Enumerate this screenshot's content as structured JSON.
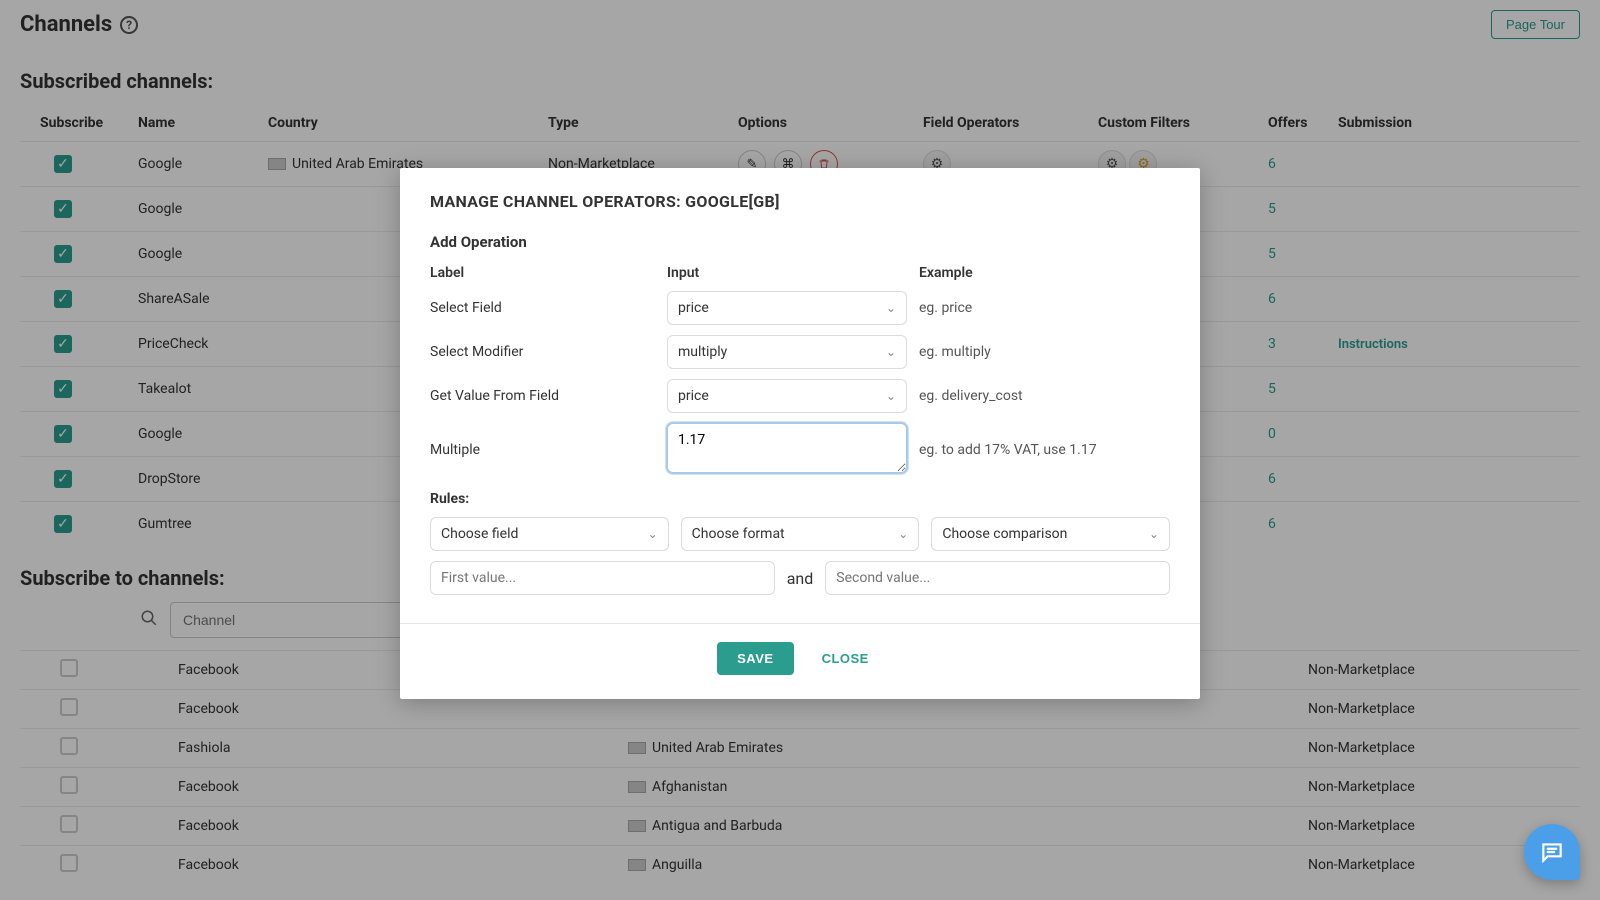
{
  "header": {
    "title": "Channels",
    "page_tour": "Page Tour"
  },
  "subscribed": {
    "title": "Subscribed channels:",
    "columns": {
      "subscribe": "Subscribe",
      "name": "Name",
      "country": "Country",
      "type": "Type",
      "options": "Options",
      "field_operators": "Field Operators",
      "custom_filters": "Custom Filters",
      "offers": "Offers",
      "submission": "Submission"
    },
    "rows": [
      {
        "name": "Google",
        "country": "United Arab Emirates",
        "type": "Non-Marketplace",
        "offers": "6",
        "submission": ""
      },
      {
        "name": "Google",
        "country": "",
        "type": "",
        "offers": "5",
        "submission": ""
      },
      {
        "name": "Google",
        "country": "",
        "type": "",
        "offers": "5",
        "submission": ""
      },
      {
        "name": "ShareASale",
        "country": "",
        "type": "",
        "offers": "6",
        "submission": ""
      },
      {
        "name": "PriceCheck",
        "country": "",
        "type": "",
        "offers": "3",
        "submission": "Instructions"
      },
      {
        "name": "Takealot",
        "country": "",
        "type": "",
        "offers": "5",
        "submission": ""
      },
      {
        "name": "Google",
        "country": "",
        "type": "",
        "offers": "0",
        "submission": ""
      },
      {
        "name": "DropStore",
        "country": "",
        "type": "",
        "offers": "6",
        "submission": ""
      },
      {
        "name": "Gumtree",
        "country": "",
        "type": "",
        "offers": "6",
        "submission": ""
      }
    ]
  },
  "available": {
    "title": "Subscribe to channels:",
    "search_placeholder": "Channel",
    "rows": [
      {
        "name": "Facebook",
        "country": "",
        "type": "Non-Marketplace"
      },
      {
        "name": "Facebook",
        "country": "",
        "type": "Non-Marketplace"
      },
      {
        "name": "Fashiola",
        "country": "United Arab Emirates",
        "type": "Non-Marketplace"
      },
      {
        "name": "Facebook",
        "country": "Afghanistan",
        "type": "Non-Marketplace"
      },
      {
        "name": "Facebook",
        "country": "Antigua and Barbuda",
        "type": "Non-Marketplace"
      },
      {
        "name": "Facebook",
        "country": "Anguilla",
        "type": "Non-Marketplace"
      }
    ]
  },
  "modal": {
    "title": "MANAGE CHANNEL OPERATORS: GOOGLE[GB]",
    "subtitle": "Add Operation",
    "headers": {
      "label": "Label",
      "input": "Input",
      "example": "Example"
    },
    "rows": {
      "select_field": {
        "label": "Select Field",
        "value": "price",
        "example": "eg. price"
      },
      "select_modifier": {
        "label": "Select Modifier",
        "value": "multiply",
        "example": "eg. multiply"
      },
      "get_value": {
        "label": "Get Value From Field",
        "value": "price",
        "example": "eg. delivery_cost"
      },
      "multiple": {
        "label": "Multiple",
        "value": "1.17",
        "example": "eg. to add 17% VAT, use 1.17"
      }
    },
    "rules_label": "Rules:",
    "rules": {
      "field_placeholder": "Choose field",
      "format_placeholder": "Choose format",
      "comparison_placeholder": "Choose comparison",
      "first_value_placeholder": "First value...",
      "and_label": "and",
      "second_value_placeholder": "Second value..."
    },
    "save": "SAVE",
    "close": "CLOSE"
  }
}
